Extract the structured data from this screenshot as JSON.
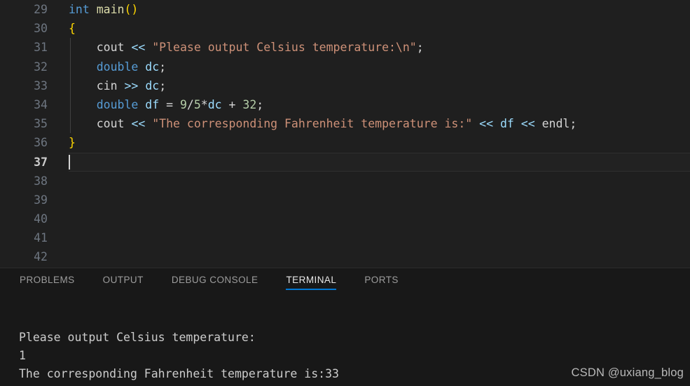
{
  "editor": {
    "background": "#1f1f1f",
    "first_line_number": 29,
    "active_line_number": 37,
    "lines": [
      {
        "number": "29",
        "tokens": [
          {
            "t": "int ",
            "c": "kw"
          },
          {
            "t": "main",
            "c": "fn"
          },
          {
            "t": "()",
            "c": "brc"
          }
        ]
      },
      {
        "number": "30",
        "tokens": [
          {
            "t": "{",
            "c": "brc"
          }
        ]
      },
      {
        "number": "31",
        "tokens": [
          {
            "t": "    ",
            "c": "pln"
          },
          {
            "t": "cout",
            "c": "pln"
          },
          {
            "t": " ",
            "c": "pln"
          },
          {
            "t": "<<",
            "c": "var"
          },
          {
            "t": " ",
            "c": "pln"
          },
          {
            "t": "\"Please output Celsius temperature:\\n\"",
            "c": "str"
          },
          {
            "t": ";",
            "c": "pln"
          }
        ]
      },
      {
        "number": "32",
        "tokens": [
          {
            "t": "    ",
            "c": "pln"
          },
          {
            "t": "double",
            "c": "kw"
          },
          {
            "t": " ",
            "c": "pln"
          },
          {
            "t": "dc",
            "c": "var"
          },
          {
            "t": ";",
            "c": "pln"
          }
        ]
      },
      {
        "number": "33",
        "tokens": [
          {
            "t": "    ",
            "c": "pln"
          },
          {
            "t": "cin",
            "c": "pln"
          },
          {
            "t": " ",
            "c": "pln"
          },
          {
            "t": ">>",
            "c": "var"
          },
          {
            "t": " ",
            "c": "pln"
          },
          {
            "t": "dc",
            "c": "var"
          },
          {
            "t": ";",
            "c": "pln"
          }
        ]
      },
      {
        "number": "34",
        "tokens": [
          {
            "t": "    ",
            "c": "pln"
          },
          {
            "t": "double",
            "c": "kw"
          },
          {
            "t": " ",
            "c": "pln"
          },
          {
            "t": "df",
            "c": "var"
          },
          {
            "t": " = ",
            "c": "pln"
          },
          {
            "t": "9",
            "c": "num"
          },
          {
            "t": "/",
            "c": "pln"
          },
          {
            "t": "5",
            "c": "num"
          },
          {
            "t": "*",
            "c": "pln"
          },
          {
            "t": "dc",
            "c": "var"
          },
          {
            "t": " + ",
            "c": "pln"
          },
          {
            "t": "32",
            "c": "num"
          },
          {
            "t": ";",
            "c": "pln"
          }
        ]
      },
      {
        "number": "35",
        "tokens": [
          {
            "t": "    ",
            "c": "pln"
          },
          {
            "t": "cout",
            "c": "pln"
          },
          {
            "t": " ",
            "c": "pln"
          },
          {
            "t": "<<",
            "c": "var"
          },
          {
            "t": " ",
            "c": "pln"
          },
          {
            "t": "\"The corresponding Fahrenheit temperature is:\"",
            "c": "str"
          },
          {
            "t": " ",
            "c": "pln"
          },
          {
            "t": "<<",
            "c": "var"
          },
          {
            "t": " ",
            "c": "pln"
          },
          {
            "t": "df",
            "c": "var"
          },
          {
            "t": " ",
            "c": "pln"
          },
          {
            "t": "<<",
            "c": "var"
          },
          {
            "t": " ",
            "c": "pln"
          },
          {
            "t": "endl",
            "c": "pln"
          },
          {
            "t": ";",
            "c": "pln"
          }
        ]
      },
      {
        "number": "36",
        "tokens": [
          {
            "t": "}",
            "c": "brc"
          }
        ]
      },
      {
        "number": "37",
        "tokens": []
      },
      {
        "number": "38",
        "tokens": []
      },
      {
        "number": "39",
        "tokens": []
      },
      {
        "number": "40",
        "tokens": []
      },
      {
        "number": "41",
        "tokens": []
      },
      {
        "number": "42",
        "tokens": []
      }
    ]
  },
  "panel": {
    "tabs": [
      {
        "label": "PROBLEMS",
        "active": false
      },
      {
        "label": "OUTPUT",
        "active": false
      },
      {
        "label": "DEBUG CONSOLE",
        "active": false
      },
      {
        "label": "TERMINAL",
        "active": true
      },
      {
        "label": "PORTS",
        "active": false
      }
    ],
    "active_tab_underline_color": "#0078d4",
    "terminal_output": "Please output Celsius temperature:\n1\nThe corresponding Fahrenheit temperature is:33"
  },
  "watermark": {
    "text": "CSDN @uxiang_blog"
  }
}
